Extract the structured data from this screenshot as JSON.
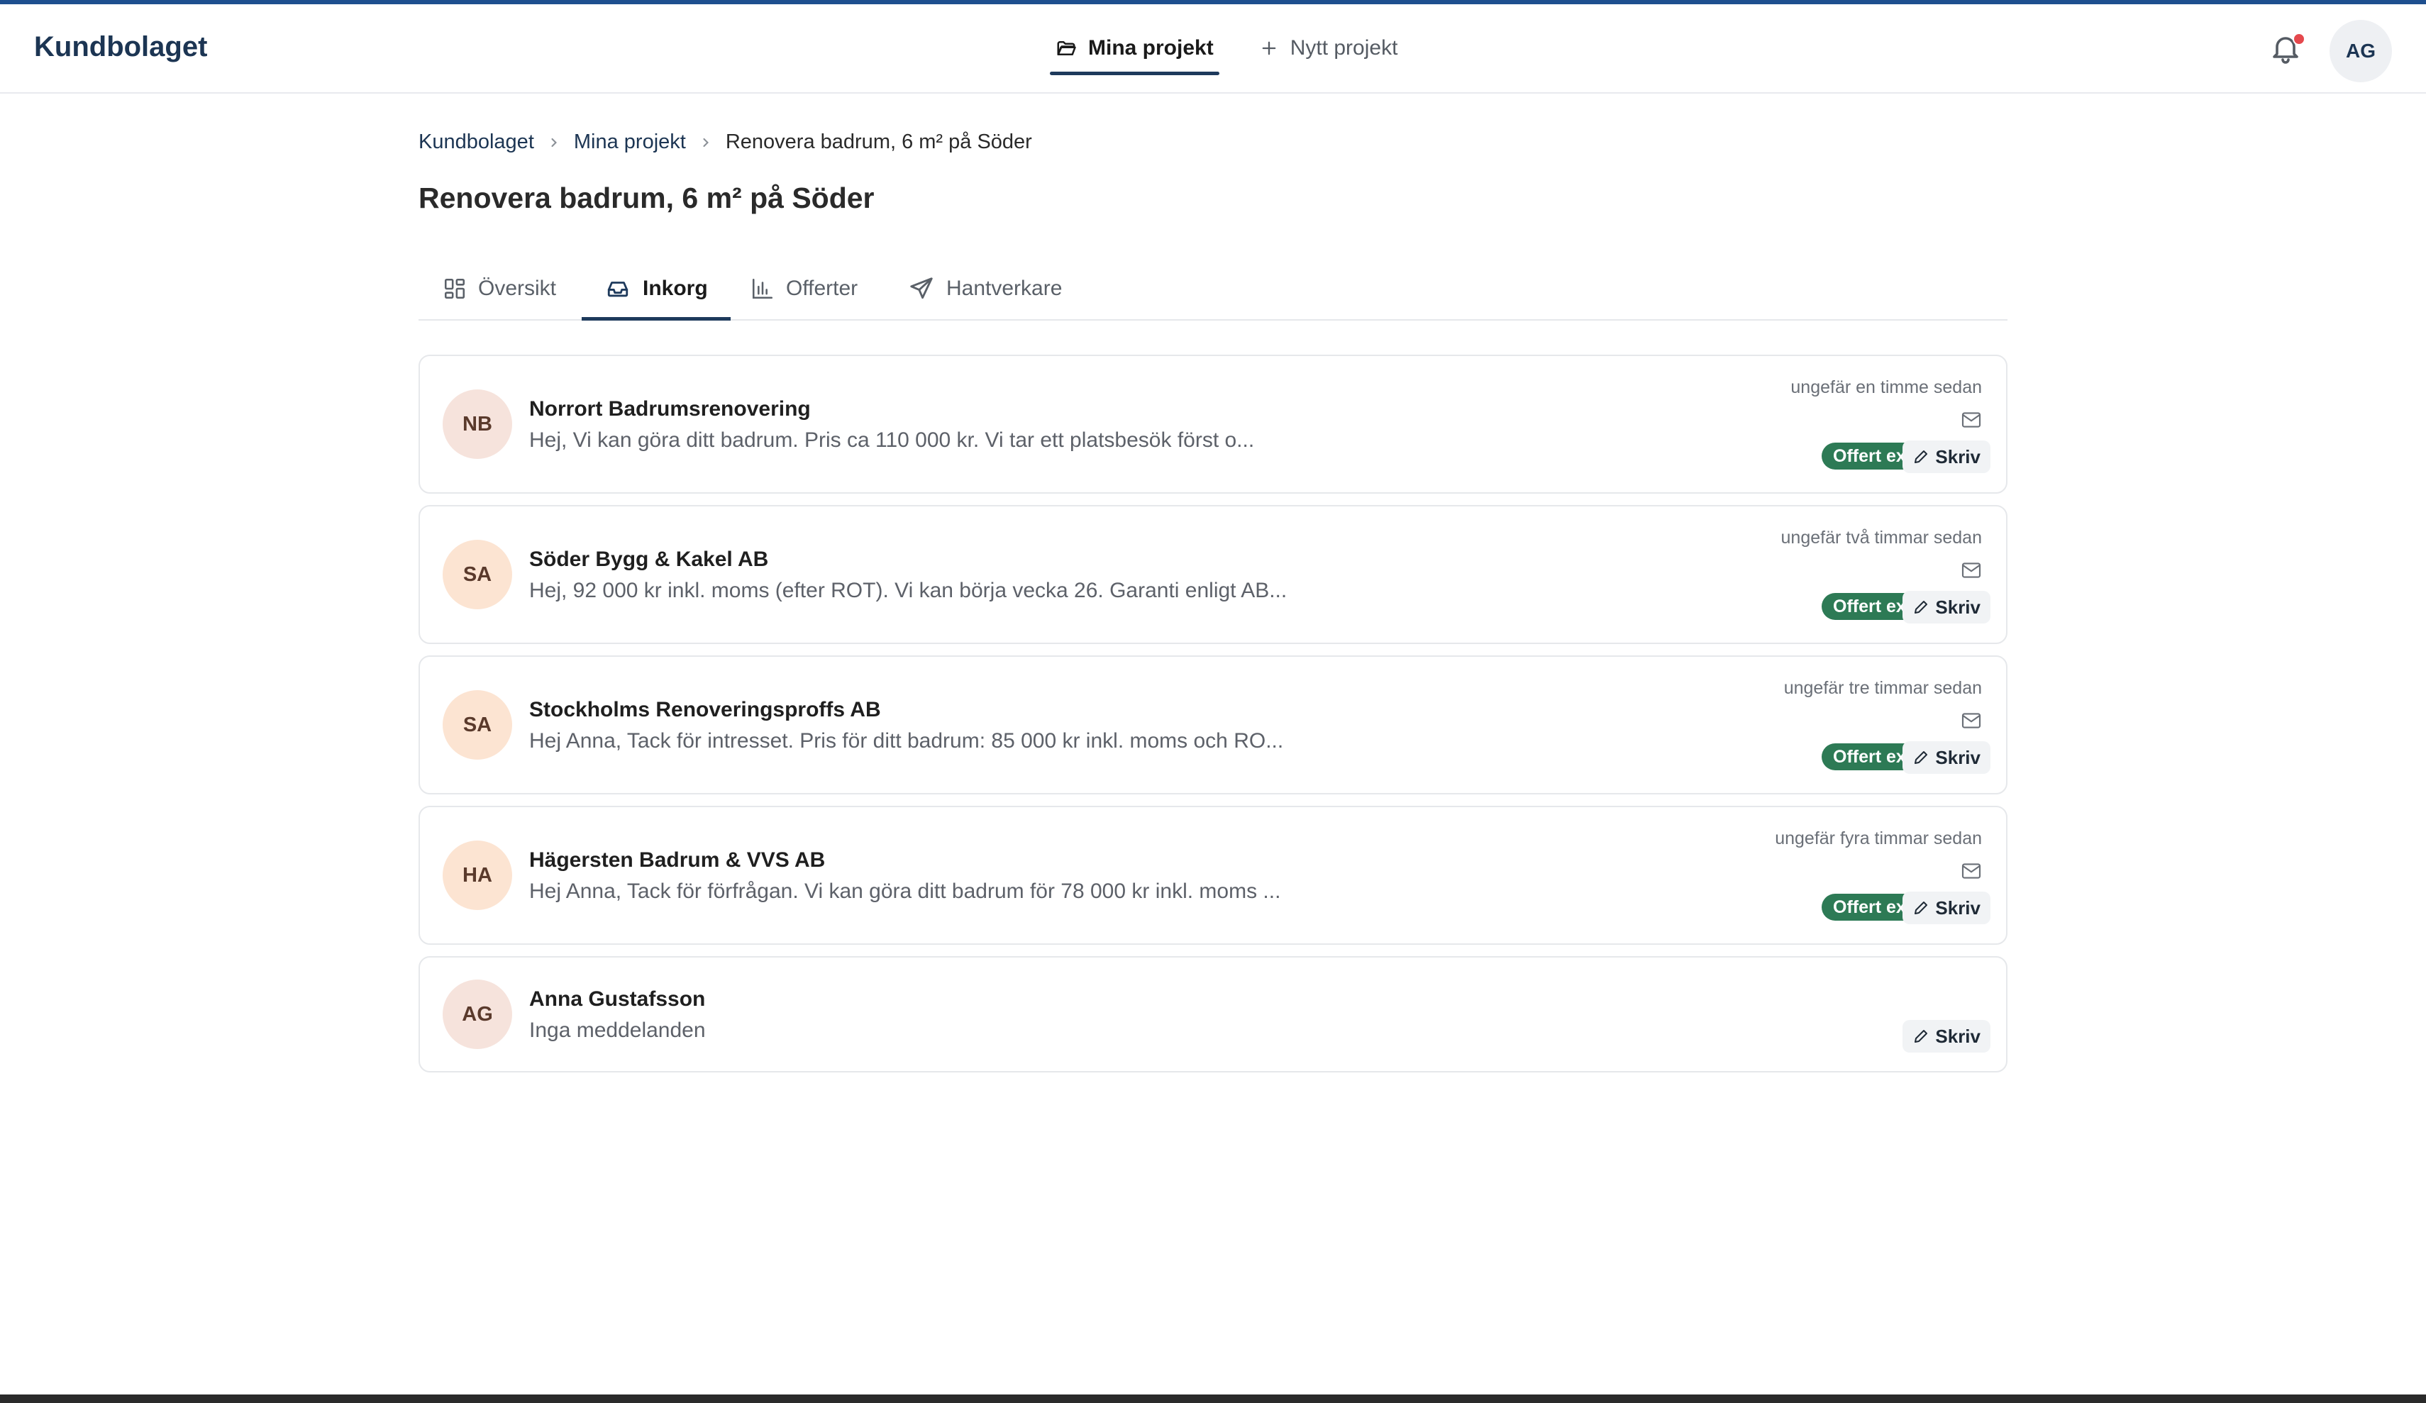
{
  "app": {
    "brand": "Kundbolaget",
    "user_initials": "AG"
  },
  "nav": [
    {
      "label": "Mina projekt",
      "icon": "folder-icon",
      "active": true
    },
    {
      "label": "Nytt projekt",
      "icon": "plus-icon",
      "active": false
    }
  ],
  "breadcrumb": [
    "Kundbolaget",
    "Mina projekt",
    "Renovera badrum, 6 m² på Söder"
  ],
  "page": {
    "title": "Renovera badrum, 6 m² på Söder"
  },
  "tabs": [
    {
      "label": "Översikt",
      "icon": "dashboard-icon",
      "active": false
    },
    {
      "label": "Inkorg",
      "icon": "inbox-icon",
      "active": true
    },
    {
      "label": "Offerter",
      "icon": "bar-chart-icon",
      "active": false
    },
    {
      "label": "Hantverkare",
      "icon": "send-icon",
      "active": false
    }
  ],
  "conversations": [
    {
      "initials": "NB",
      "avatar_color": "#f6e3dc",
      "name": "Norrort Badrumsrenovering",
      "preview": "Hej, Vi kan göra ditt badrum. Pris ca 110 000 kr. Vi tar ett platsbesök först o...",
      "time": "ungefär en timme sedan",
      "badge": "Offert ex",
      "write": "Skriv"
    },
    {
      "initials": "SA",
      "avatar_color": "#fce4d2",
      "name": "Söder Bygg & Kakel AB",
      "preview": "Hej, 92 000 kr inkl. moms (efter ROT). Vi kan börja vecka 26. Garanti enligt AB...",
      "time": "ungefär två timmar sedan",
      "badge": "Offert ex",
      "write": "Skriv"
    },
    {
      "initials": "SA",
      "avatar_color": "#fce4d2",
      "name": "Stockholms Renoveringsproffs AB",
      "preview": "Hej Anna, Tack för intresset. Pris för ditt badrum: 85 000 kr inkl. moms och RO...",
      "time": "ungefär tre timmar sedan",
      "badge": "Offert ex",
      "write": "Skriv"
    },
    {
      "initials": "HA",
      "avatar_color": "#fce4d2",
      "name": "Hägersten Badrum & VVS AB",
      "preview": "Hej Anna, Tack för förfrågan. Vi kan göra ditt badrum för 78 000 kr inkl. moms ...",
      "time": "ungefär fyra timmar sedan",
      "badge": "Offert ex",
      "write": "Skriv"
    },
    {
      "initials": "AG",
      "avatar_color": "#f6e3dc",
      "name": "Anna Gustafsson",
      "preview": "Inga meddelanden",
      "time": "",
      "badge": "",
      "write": "Skriv"
    }
  ]
}
